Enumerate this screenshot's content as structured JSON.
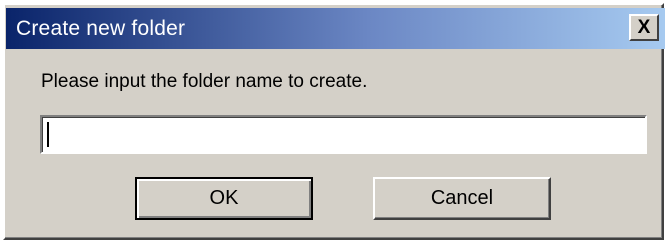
{
  "window": {
    "title": "Create new folder",
    "close_label": "X",
    "close_icon": "close-icon"
  },
  "form": {
    "prompt": "Please input the folder name to create.",
    "folder_name_value": "",
    "folder_name_placeholder": ""
  },
  "buttons": {
    "ok_label": "OK",
    "cancel_label": "Cancel"
  },
  "colors": {
    "titlebar_start": "#0a246a",
    "titlebar_end": "#a6caf0",
    "dialog_face": "#d4d0c8"
  }
}
